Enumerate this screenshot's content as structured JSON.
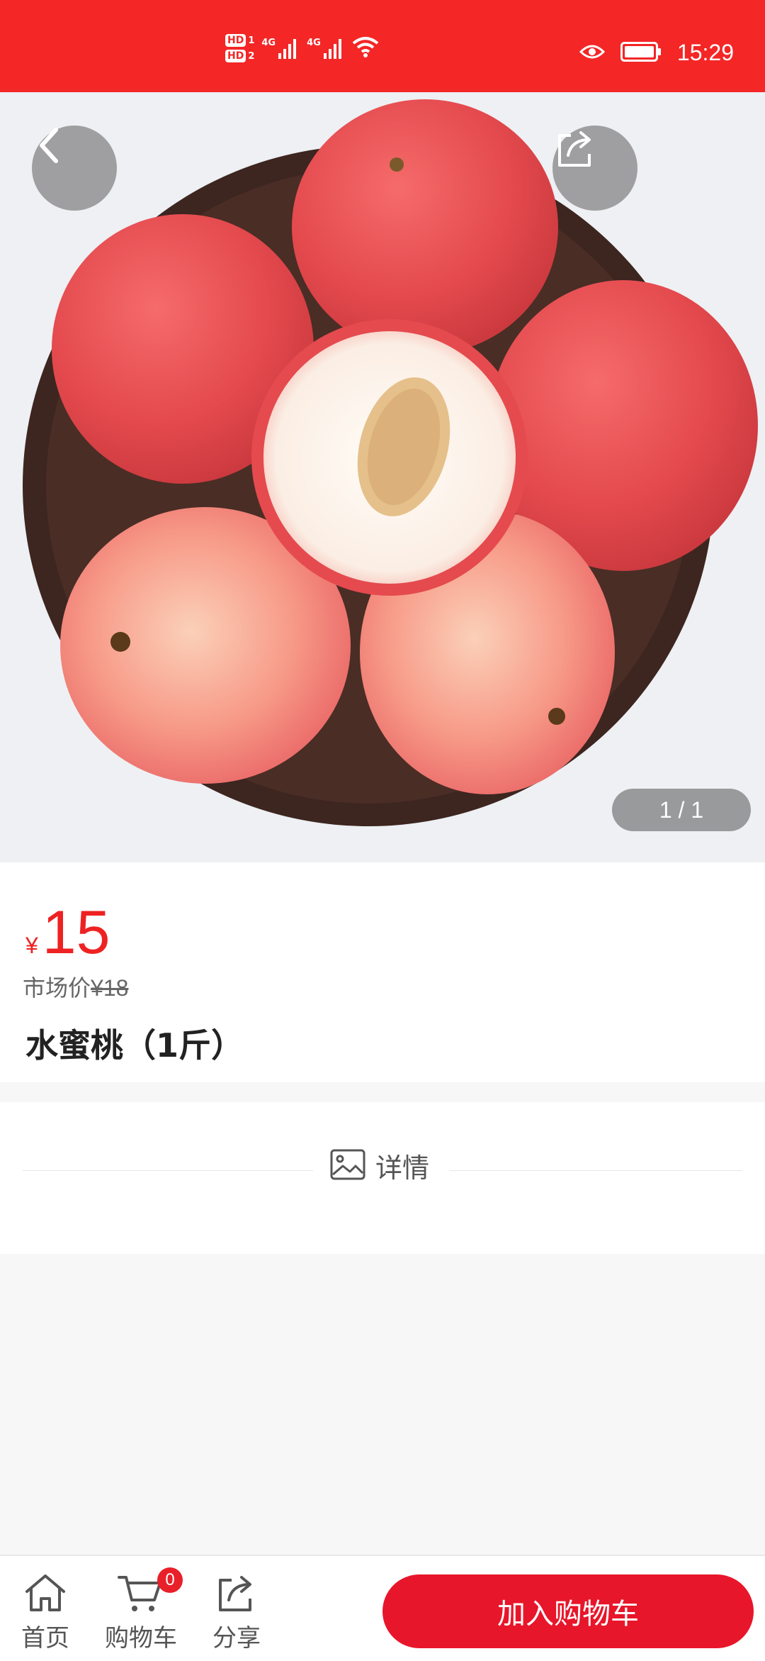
{
  "status_bar": {
    "time": "15:29",
    "hd1": "HD",
    "hd1_sub": "1",
    "hd2": "HD",
    "hd2_sub": "2",
    "net1": "4G",
    "net2": "4G",
    "icons": [
      "wifi-icon",
      "eye-icon",
      "battery-icon"
    ]
  },
  "hero": {
    "image_counter": "1 / 1",
    "image_subject": "peaches on wooden plate"
  },
  "product": {
    "currency_symbol": "¥",
    "price": "15",
    "market_label": "市场价",
    "market_price": "¥18",
    "title": "水蜜桃（1斤）"
  },
  "detail": {
    "label": "详情"
  },
  "bottom_nav": {
    "home_label": "首页",
    "cart_label": "购物车",
    "cart_count": "0",
    "share_label": "分享",
    "add_to_cart_label": "加入购物车"
  },
  "colors": {
    "brand_red": "#f42626",
    "price_red": "#ee2222",
    "button_red": "#e8162a"
  }
}
